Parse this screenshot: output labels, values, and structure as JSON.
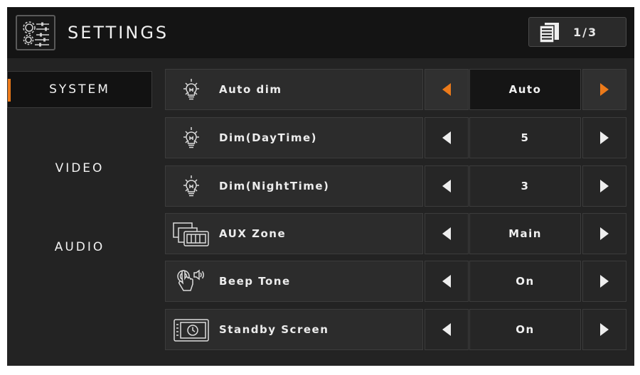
{
  "header": {
    "title": "SETTINGS",
    "page_indicator": "1/3",
    "icon": "settings-gears-icon",
    "pager_icon": "pages-icon"
  },
  "sidebar": {
    "items": [
      {
        "label": "SYSTEM",
        "active": true
      },
      {
        "label": "VIDEO",
        "active": false
      },
      {
        "label": "AUDIO",
        "active": false
      }
    ]
  },
  "settings": [
    {
      "label": "Auto dim",
      "value": "Auto",
      "icon": "lightbulb-icon",
      "highlighted": true
    },
    {
      "label": "Dim(DayTime)",
      "value": "5",
      "icon": "lightbulb-icon",
      "highlighted": false
    },
    {
      "label": "Dim(NightTime)",
      "value": "3",
      "icon": "lightbulb-icon",
      "highlighted": false
    },
    {
      "label": "AUX Zone",
      "value": "Main",
      "icon": "aux-zone-icon",
      "highlighted": false
    },
    {
      "label": "Beep Tone",
      "value": "On",
      "icon": "beep-touch-icon",
      "highlighted": false
    },
    {
      "label": "Standby Screen",
      "value": "On",
      "icon": "standby-clock-icon",
      "highlighted": false
    }
  ],
  "colors": {
    "accent": "#ec7a1a",
    "arrow_default": "#eeeeee",
    "background": "#232323",
    "header": "#141414"
  }
}
